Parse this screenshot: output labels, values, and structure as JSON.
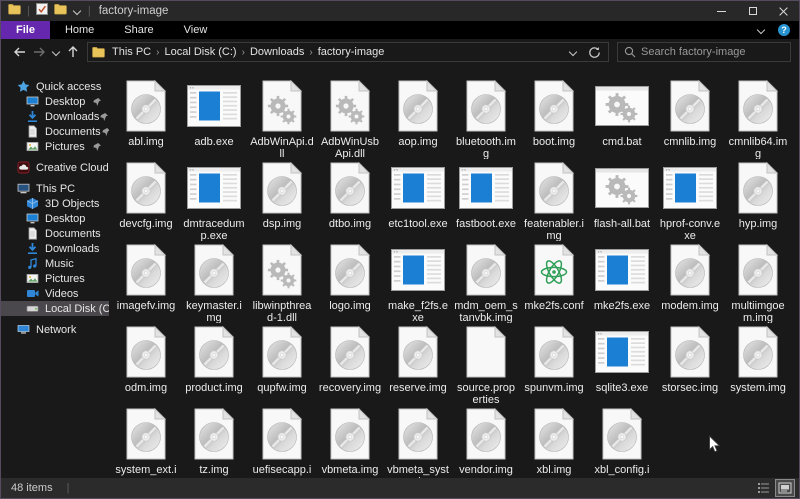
{
  "window": {
    "title": "factory-image"
  },
  "colors": {
    "accent_purple": "#6527ad",
    "help_blue": "#2792d0",
    "exe_blue": "#1b7fd4",
    "atom_green": "#2f9e57",
    "folder_yellow": "#e8c35a",
    "background": "#191919",
    "titlebar": "#282828",
    "statusbar": "#2b2b2b"
  },
  "titlebar": {
    "qat_icons": [
      "folder-icon",
      "properties-check-icon",
      "folder-icon",
      "chevron-down-icon"
    ]
  },
  "ribbon": {
    "tabs": [
      {
        "label": "File",
        "active": true
      },
      {
        "label": "Home",
        "active": false
      },
      {
        "label": "Share",
        "active": false
      },
      {
        "label": "View",
        "active": false
      }
    ]
  },
  "toolbar": {
    "breadcrumb": [
      "This PC",
      "Local Disk (C:)",
      "Downloads",
      "factory-image"
    ],
    "search_placeholder": "Search factory-image"
  },
  "sidebar": {
    "sections": [
      {
        "label": "Quick access",
        "icon": "star",
        "items": [
          {
            "label": "Desktop",
            "icon": "desktop",
            "pinned": true
          },
          {
            "label": "Downloads",
            "icon": "download",
            "pinned": true
          },
          {
            "label": "Documents",
            "icon": "document",
            "pinned": true
          },
          {
            "label": "Pictures",
            "icon": "pictures",
            "pinned": true
          }
        ]
      },
      {
        "label": "Creative Cloud Files",
        "icon": "creative-cloud",
        "items": []
      },
      {
        "label": "This PC",
        "icon": "computer",
        "items": [
          {
            "label": "3D Objects",
            "icon": "cube"
          },
          {
            "label": "Desktop",
            "icon": "desktop"
          },
          {
            "label": "Documents",
            "icon": "document"
          },
          {
            "label": "Downloads",
            "icon": "download"
          },
          {
            "label": "Music",
            "icon": "music"
          },
          {
            "label": "Pictures",
            "icon": "pictures"
          },
          {
            "label": "Videos",
            "icon": "videos"
          },
          {
            "label": "Local Disk (C:)",
            "icon": "drive",
            "selected": true
          }
        ]
      },
      {
        "label": "Network",
        "icon": "network",
        "items": []
      }
    ]
  },
  "files": {
    "items": [
      {
        "name": "abl.img",
        "type": "img"
      },
      {
        "name": "adb.exe",
        "type": "exe"
      },
      {
        "name": "AdbWinApi.dll",
        "type": "dll"
      },
      {
        "name": "AdbWinUsbApi.dll",
        "type": "dll"
      },
      {
        "name": "aop.img",
        "type": "img"
      },
      {
        "name": "bluetooth.img",
        "type": "img"
      },
      {
        "name": "boot.img",
        "type": "img"
      },
      {
        "name": "cmd.bat",
        "type": "bat"
      },
      {
        "name": "cmnlib.img",
        "type": "img"
      },
      {
        "name": "cmnlib64.img",
        "type": "img"
      },
      {
        "name": "devcfg.img",
        "type": "img"
      },
      {
        "name": "dmtracedump.exe",
        "type": "exe"
      },
      {
        "name": "dsp.img",
        "type": "img"
      },
      {
        "name": "dtbo.img",
        "type": "img"
      },
      {
        "name": "etc1tool.exe",
        "type": "exe"
      },
      {
        "name": "fastboot.exe",
        "type": "exe"
      },
      {
        "name": "featenabler.img",
        "type": "img"
      },
      {
        "name": "flash-all.bat",
        "type": "bat"
      },
      {
        "name": "hprof-conv.exe",
        "type": "exe"
      },
      {
        "name": "hyp.img",
        "type": "img"
      },
      {
        "name": "imagefv.img",
        "type": "img"
      },
      {
        "name": "keymaster.img",
        "type": "img"
      },
      {
        "name": "libwinpthread-1.dll",
        "type": "dll"
      },
      {
        "name": "logo.img",
        "type": "img"
      },
      {
        "name": "make_f2fs.exe",
        "type": "exe"
      },
      {
        "name": "mdm_oem_stanvbk.img",
        "type": "img"
      },
      {
        "name": "mke2fs.conf",
        "type": "conf"
      },
      {
        "name": "mke2fs.exe",
        "type": "exe"
      },
      {
        "name": "modem.img",
        "type": "img"
      },
      {
        "name": "multiimgoem.img",
        "type": "img"
      },
      {
        "name": "odm.img",
        "type": "img"
      },
      {
        "name": "product.img",
        "type": "img"
      },
      {
        "name": "qupfw.img",
        "type": "img"
      },
      {
        "name": "recovery.img",
        "type": "img"
      },
      {
        "name": "reserve.img",
        "type": "img"
      },
      {
        "name": "source.properties",
        "type": "properties"
      },
      {
        "name": "spunvm.img",
        "type": "img"
      },
      {
        "name": "sqlite3.exe",
        "type": "exe"
      },
      {
        "name": "storsec.img",
        "type": "img"
      },
      {
        "name": "system.img",
        "type": "img"
      },
      {
        "name": "system_ext.img",
        "type": "img"
      },
      {
        "name": "tz.img",
        "type": "img"
      },
      {
        "name": "uefisecapp.img",
        "type": "img"
      },
      {
        "name": "vbmeta.img",
        "type": "img"
      },
      {
        "name": "vbmeta_system.img",
        "type": "img"
      },
      {
        "name": "vendor.img",
        "type": "img"
      },
      {
        "name": "xbl.img",
        "type": "img"
      },
      {
        "name": "xbl_config.img",
        "type": "img"
      }
    ]
  },
  "status": {
    "items_count": "48 items",
    "view_toggles": [
      "details-view",
      "large-icons-view"
    ]
  }
}
